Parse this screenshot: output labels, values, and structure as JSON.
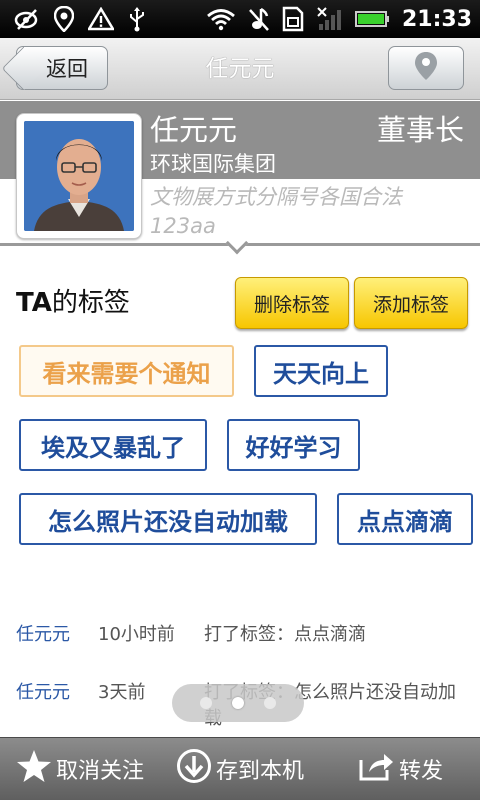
{
  "status_bar": {
    "time": "21:33",
    "left_icons": [
      "eye-off-icon",
      "location-pin-icon",
      "warning-icon",
      "usb-icon"
    ],
    "right_icons": [
      "wifi-icon",
      "no-sound-icon",
      "sim-icon",
      "signal-icon",
      "battery-icon"
    ]
  },
  "title_bar": {
    "back_label": "返回",
    "title": "任元元",
    "right_icon": "location-pin-icon"
  },
  "profile": {
    "name": "任元元",
    "position": "董事长",
    "company": "环球国际集团",
    "signature": "文物展方式分隔号各国合法123aa"
  },
  "tags_section": {
    "title_prefix": "TA",
    "title_suffix": "的标签",
    "delete_label": "删除标签",
    "add_label": "添加标签",
    "tags": [
      {
        "label": "看来需要个通知",
        "selected": true
      },
      {
        "label": "天天向上",
        "selected": false
      },
      {
        "label": "埃及又暴乱了",
        "selected": false
      },
      {
        "label": "好好学习",
        "selected": false
      },
      {
        "label": "怎么照片还没自动加载",
        "selected": false
      },
      {
        "label": "点点滴滴",
        "selected": false
      }
    ]
  },
  "activity": [
    {
      "user": "任元元",
      "time": "10小时前",
      "text": "打了标签：点点滴滴"
    },
    {
      "user": "任元元",
      "time": "3天前",
      "text": "打了标签：怎么照片还没自动加载"
    }
  ],
  "pager": {
    "count": 3,
    "active_index": 1
  },
  "bottom_bar": {
    "unfollow_label": "取消关注",
    "save_label": "存到本机",
    "forward_label": "转发"
  }
}
